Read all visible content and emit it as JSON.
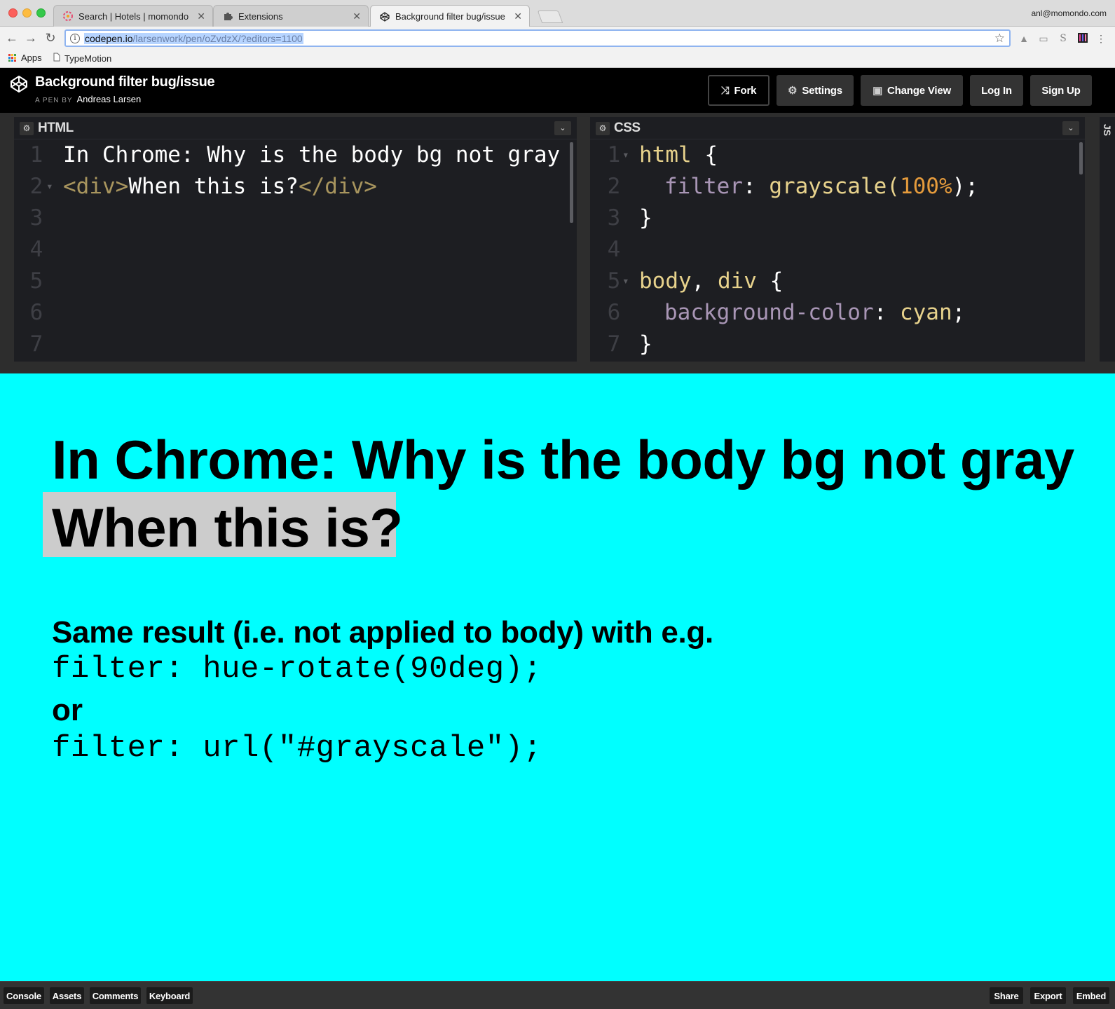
{
  "browser": {
    "tabs": [
      {
        "title": "Search | Hotels | momondo",
        "icon": "momondo-favicon",
        "active": false
      },
      {
        "title": "Extensions",
        "icon": "puzzle-icon",
        "active": false
      },
      {
        "title": "Background filter bug/issue",
        "icon": "codepen-favicon",
        "active": true
      }
    ],
    "profile": "anl@momondo.com",
    "url_host": "codepen.io",
    "url_path": "/larsenwork/pen/oZvdzX/?editors=1100",
    "bookmarks": [
      {
        "label": "Apps",
        "icon": "apps-grid-icon"
      },
      {
        "label": "TypeMotion",
        "icon": "page-icon"
      }
    ]
  },
  "codepen": {
    "title": "Background filter bug/issue",
    "byline_prefix": "A PEN BY",
    "author": "Andreas Larsen",
    "buttons": {
      "fork": "Fork",
      "settings": "Settings",
      "change_view": "Change View",
      "log_in": "Log In",
      "sign_up": "Sign Up"
    },
    "html_pane": {
      "label": "HTML",
      "line_numbers": [
        "1",
        "2",
        "3",
        "4",
        "5",
        "6",
        "7"
      ],
      "line1": "In Chrome: Why is the body bg not gray",
      "line2_open": "<div>",
      "line2_text": "When this is?",
      "line2_close": "</div>"
    },
    "css_pane": {
      "label": "CSS",
      "line_numbers": [
        "1",
        "2",
        "3",
        "4",
        "5",
        "6",
        "7"
      ],
      "l1_sel": "html",
      "l1_brace": " {",
      "l2_prop": "filter",
      "l2_colon": ": ",
      "l2_fn": "grayscale(",
      "l2_num": "100%",
      "l2_end": ");",
      "l3": "}",
      "l5_sel": "body",
      "l5_comma": ", ",
      "l5_sel2": "div",
      "l5_brace": " {",
      "l6_prop": "background-color",
      "l6_colon": ": ",
      "l6_val": "cyan",
      "l6_end": ";",
      "l7": "}"
    },
    "js_pane_label": "JS",
    "footer": {
      "left": [
        "Console",
        "Assets",
        "Comments",
        "Keyboard"
      ],
      "right": [
        "Share",
        "Export",
        "Embed"
      ]
    }
  },
  "preview": {
    "heading": "In Chrome: Why is the body bg not gray",
    "div_text": "When this is?",
    "note": "Same result (i.e. not applied to body) with e.g.",
    "code1": "filter: hue-rotate(90deg);",
    "or": "or",
    "code2": "filter: url(\"#grayscale\");",
    "background_color": "#00ffff",
    "div_background": "#cccccc"
  }
}
